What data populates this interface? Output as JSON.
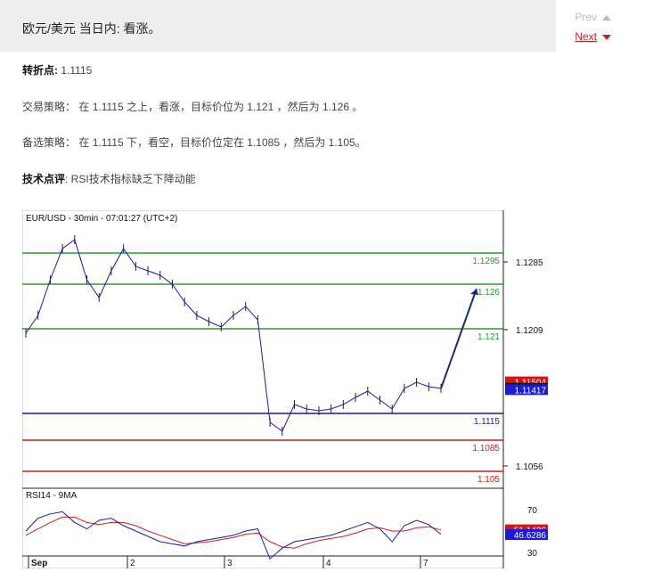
{
  "header": {
    "title": "欧元/美元 当日内: 看涨。",
    "prev": "Prev",
    "next": "Next"
  },
  "pivot": {
    "label": "转折点:",
    "value": "1.1115"
  },
  "strategy": {
    "label": "交易策略：",
    "text": "在 1.1115 之上，看涨，目标价位为 1.121 ，然后为 1.126 。"
  },
  "alternative": {
    "label": "备选策略：",
    "text": "在 1.1115 下，看空，目标价位定在 1.1085 ，然后为 1.105。"
  },
  "comment": {
    "label": "技术点评",
    "text": ": RSI技术指标缺乏下降动能"
  },
  "chart_data": {
    "type": "line",
    "title": "EUR/USD - 30min - 07:01:27 (UTC+2)",
    "price_ylim": [
      1.1035,
      1.1335
    ],
    "x_labels": [
      "Sep",
      "2",
      "3",
      "4",
      "7"
    ],
    "y_ticks": [
      "1.1285",
      "1.1209",
      "1.1056"
    ],
    "levels": [
      {
        "label": "1.1295",
        "value": 1.1295,
        "color": "#2e9a2e",
        "text_color": "#2e9a2e"
      },
      {
        "label": "1.126",
        "value": 1.126,
        "color": "#2e9a2e",
        "text_color": "#2e9a2e"
      },
      {
        "label": "1.121",
        "value": 1.121,
        "color": "#2e9a2e",
        "text_color": "#2e9a2e"
      },
      {
        "label": "1.1115",
        "value": 1.1115,
        "color": "#1a1aaa",
        "text_color": "#1a1aaa"
      },
      {
        "label": "1.1085",
        "value": 1.1085,
        "color": "#cc1f1f",
        "text_color": "#cc1f1f"
      },
      {
        "label": "1.105",
        "value": 1.105,
        "color": "#cc1f1f",
        "text_color": "#cc1f1f"
      }
    ],
    "price_badges": [
      {
        "label": "1.11504",
        "value": 1.11504,
        "color": "#dd1111"
      },
      {
        "label": "1.11432",
        "value": 1.11432,
        "color": "#111111"
      },
      {
        "label": "1.11417",
        "value": 1.11417,
        "color": "#1a1ad9"
      }
    ],
    "close_prices": [
      1.1205,
      1.1225,
      1.1265,
      1.13,
      1.131,
      1.1265,
      1.1245,
      1.1275,
      1.13,
      1.128,
      1.1275,
      1.127,
      1.126,
      1.124,
      1.1225,
      1.1218,
      1.1212,
      1.1225,
      1.1235,
      1.122,
      1.1105,
      1.1095,
      1.1125,
      1.112,
      1.1118,
      1.112,
      1.1125,
      1.1133,
      1.114,
      1.113,
      1.112,
      1.1143,
      1.115,
      1.1145,
      1.1143
    ],
    "forecast": [
      1.1143,
      1.1255
    ],
    "rsi_title": "RSI14 - 9MA",
    "rsi_ylim": [
      20,
      80
    ],
    "rsi_ticks": [
      "70",
      "30"
    ],
    "rsi_badges": [
      {
        "label": "51.1436",
        "value": 51.1436,
        "color": "#dd1111"
      },
      {
        "label": "46.6286",
        "value": 46.6286,
        "color": "#1a1ad9"
      }
    ],
    "rsi": [
      50,
      62,
      66,
      68,
      58,
      52,
      60,
      62,
      55,
      50,
      45,
      40,
      38,
      36,
      40,
      42,
      44,
      46,
      50,
      52,
      24,
      34,
      40,
      42,
      44,
      46,
      50,
      54,
      58,
      52,
      40,
      55,
      60,
      56,
      47
    ],
    "rsi_ma": [
      46,
      52,
      58,
      63,
      63,
      58,
      56,
      58,
      58,
      55,
      50,
      46,
      42,
      38,
      39,
      40,
      42,
      44,
      47,
      48,
      40,
      35,
      34,
      38,
      41,
      43,
      45,
      48,
      52,
      53,
      50,
      50,
      53,
      54,
      51
    ]
  }
}
